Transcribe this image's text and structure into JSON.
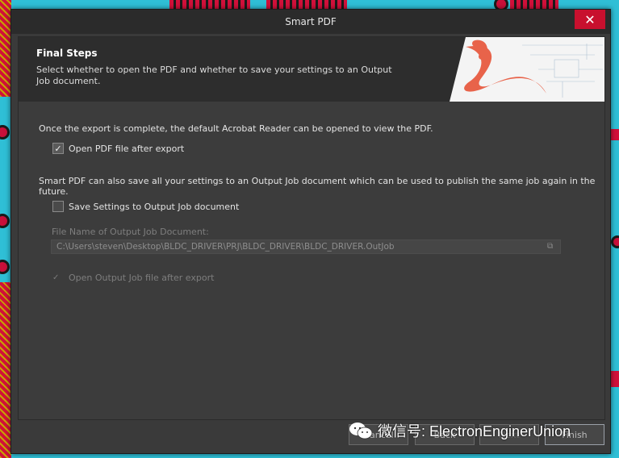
{
  "window": {
    "title": "Smart PDF",
    "close_glyph": "✕"
  },
  "header": {
    "title": "Final Steps",
    "description": "Select whether to open the PDF and whether to save your settings to an Output Job document."
  },
  "content": {
    "intro_text": "Once the export is complete, the default Acrobat Reader can be opened to view the PDF.",
    "open_pdf": {
      "label": "Open PDF file after export",
      "checked": true
    },
    "save_intro_text": "Smart PDF can also save all your settings to an Output Job document which can be used to publish the same job again in the future.",
    "save_settings": {
      "label": "Save Settings to Output Job document",
      "checked": false
    },
    "file_name_label": "File Name of Output Job Document:",
    "file_name_value": "C:\\Users\\steven\\Desktop\\BLDC_DRIVER\\PRJ\\BLDC_DRIVER\\BLDC_DRIVER.OutJob",
    "open_outjob": {
      "label": "Open Output Job file after export",
      "checked": true,
      "enabled": false
    }
  },
  "footer": {
    "cancel_label": "Cancel",
    "back_label": "Back",
    "next_label": "Next",
    "finish_label": "Finish"
  },
  "watermark": {
    "text": "微信号: ElectronEnginerUnion"
  },
  "colors": {
    "accent": "#c8102e",
    "pcb_background": "#2fbfd6",
    "pcb_pad": "#d1103a",
    "dialog_bg": "#3a3a3a"
  }
}
